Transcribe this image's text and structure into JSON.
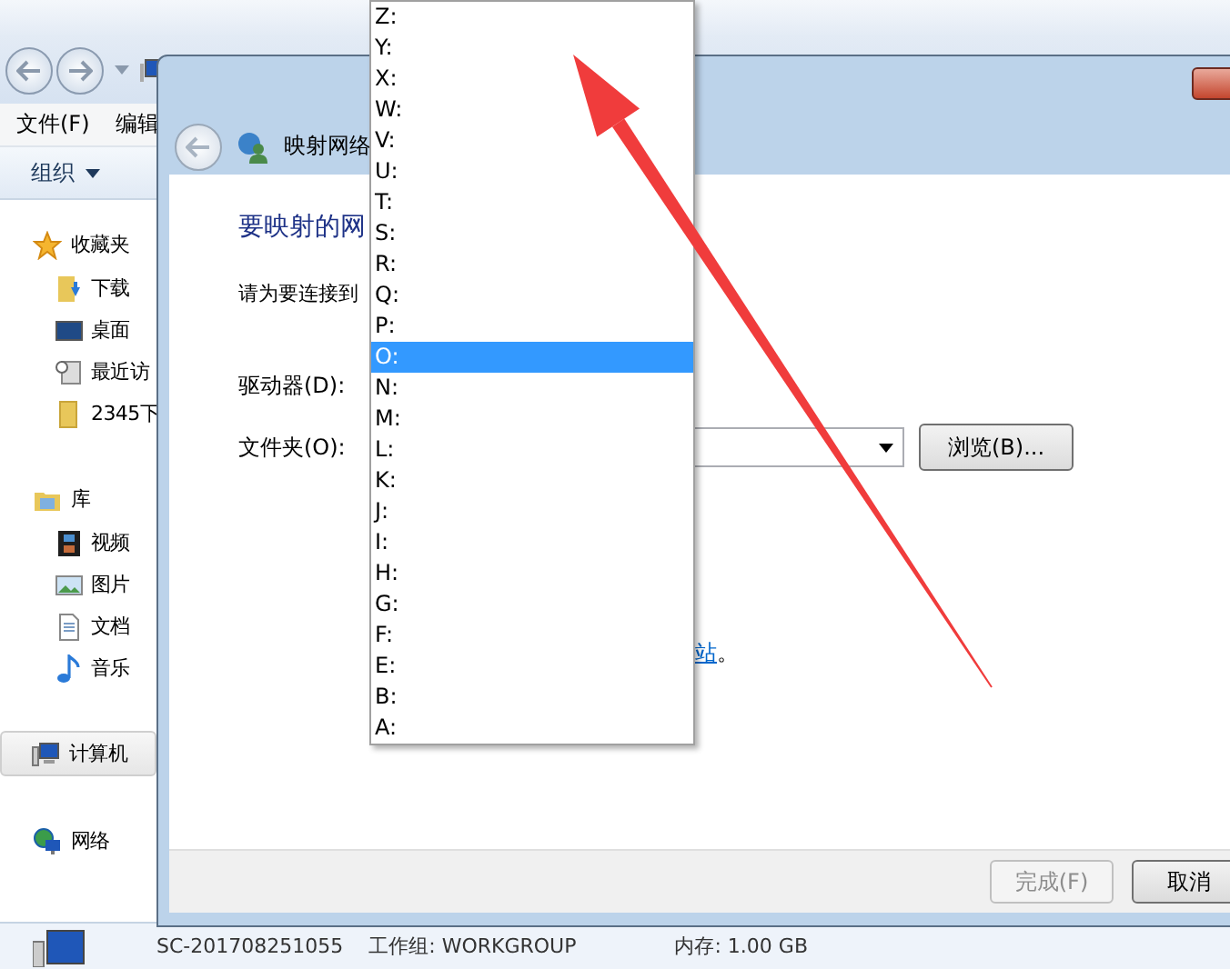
{
  "explorer": {
    "menu": [
      "文件(F)",
      "编辑"
    ],
    "toolbar": {
      "organize": "组织"
    },
    "sidebar": [
      {
        "label": "收藏夹",
        "kind": "star",
        "selected": false,
        "children": [
          {
            "label": "下载",
            "kind": "download"
          },
          {
            "label": "桌面",
            "kind": "desktop"
          },
          {
            "label": "最近访",
            "kind": "recent"
          },
          {
            "label": "2345下",
            "kind": "folder"
          }
        ]
      },
      {
        "label": "库",
        "kind": "library",
        "selected": false,
        "children": [
          {
            "label": "视频",
            "kind": "video"
          },
          {
            "label": "图片",
            "kind": "picture"
          },
          {
            "label": "文档",
            "kind": "document"
          },
          {
            "label": "音乐",
            "kind": "music"
          }
        ]
      },
      {
        "label": "计算机",
        "kind": "computer",
        "selected": true
      },
      {
        "label": "网络",
        "kind": "network",
        "selected": false
      }
    ],
    "details": {
      "computer_name": "SC-201708251055",
      "workgroup": "工作组: WORKGROUP",
      "memory": "内存: 1.00 GB"
    }
  },
  "dialog": {
    "title": "映射网络",
    "heading": "要映射的网",
    "instruction": "请为要连接到",
    "drive_label": "驱动器(D):",
    "folder_label": "文件夹(O):",
    "browse_button": "浏览(B)...",
    "link": "站",
    "link_suffix": "。",
    "buttons": [
      {
        "label": "完成(F)",
        "disabled": true
      },
      {
        "label": "取消",
        "disabled": false
      }
    ]
  },
  "drive_list": [
    {
      "label": "Z:",
      "selected": false
    },
    {
      "label": "Y:",
      "selected": false
    },
    {
      "label": "X:",
      "selected": false
    },
    {
      "label": "W:",
      "selected": false
    },
    {
      "label": "V:",
      "selected": false
    },
    {
      "label": "U:",
      "selected": false
    },
    {
      "label": "T:",
      "selected": false
    },
    {
      "label": "S:",
      "selected": false
    },
    {
      "label": "R:",
      "selected": false
    },
    {
      "label": "Q:",
      "selected": false
    },
    {
      "label": "P:",
      "selected": false
    },
    {
      "label": "O:",
      "selected": true
    },
    {
      "label": "N:",
      "selected": false
    },
    {
      "label": "M:",
      "selected": false
    },
    {
      "label": "L:",
      "selected": false
    },
    {
      "label": "K:",
      "selected": false
    },
    {
      "label": "J:",
      "selected": false
    },
    {
      "label": "I:",
      "selected": false
    },
    {
      "label": "H:",
      "selected": false
    },
    {
      "label": "G:",
      "selected": false
    },
    {
      "label": "F:",
      "selected": false
    },
    {
      "label": "E:",
      "selected": false
    },
    {
      "label": "B:",
      "selected": false
    },
    {
      "label": "A:",
      "selected": false
    }
  ]
}
